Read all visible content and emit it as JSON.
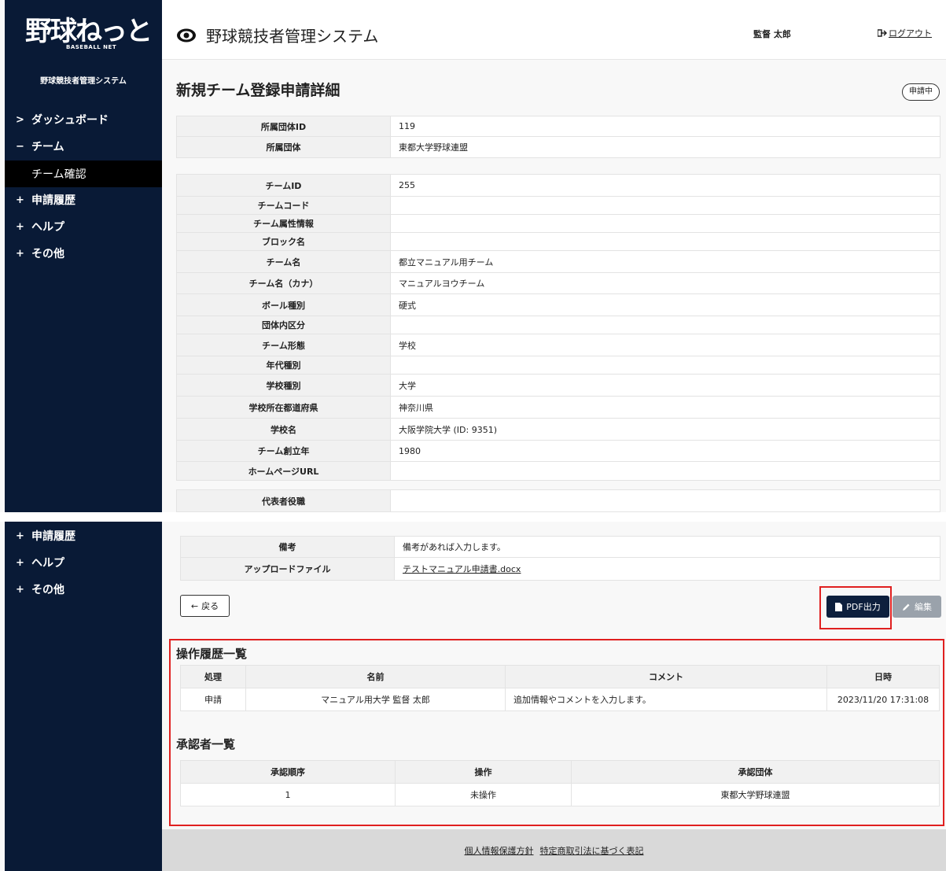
{
  "sidebar": {
    "logo_text": "野球ねっと",
    "logo_sub": "BASEBALL NET",
    "system_name": "野球競技者管理システム",
    "menu": [
      {
        "mark": ">",
        "label": "ダッシュボード"
      },
      {
        "mark": "−",
        "label": "チーム"
      },
      {
        "sub": "チーム確認"
      },
      {
        "mark": "+",
        "label": "申請履歴"
      },
      {
        "mark": "+",
        "label": "ヘルプ"
      },
      {
        "mark": "+",
        "label": "その他"
      }
    ]
  },
  "header": {
    "app_title": "野球競技者管理システム",
    "user_name": "監督 太郎",
    "logout": "ログアウト"
  },
  "page": {
    "title": "新規チーム登録申請詳細",
    "status": "申請中"
  },
  "group_table": [
    {
      "label": "所属団体ID",
      "value": "119"
    },
    {
      "label": "所属団体",
      "value": "東都大学野球連盟"
    }
  ],
  "team_table": [
    {
      "label": "チームID",
      "value": "255"
    },
    {
      "label": "チームコード",
      "value": ""
    },
    {
      "label": "チーム属性情報",
      "value": ""
    },
    {
      "label": "ブロック名",
      "value": ""
    },
    {
      "label": "チーム名",
      "value": "都立マニュアル用チーム"
    },
    {
      "label": "チーム名（カナ）",
      "value": "マニュアルヨウチーム"
    },
    {
      "label": "ボール種別",
      "value": "硬式"
    },
    {
      "label": "団体内区分",
      "value": ""
    },
    {
      "label": "チーム形態",
      "value": "学校"
    },
    {
      "label": "年代種別",
      "value": ""
    },
    {
      "label": "学校種別",
      "value": "大学"
    },
    {
      "label": "学校所在都道府県",
      "value": "神奈川県"
    },
    {
      "label": "学校名",
      "value": "大阪学院大学 (ID: 9351)"
    },
    {
      "label": "チーム創立年",
      "value": "1980"
    },
    {
      "label": "ホームページURL",
      "value": ""
    }
  ],
  "rep_table": [
    {
      "label": "代表者役職",
      "value": ""
    }
  ],
  "bottom_table": [
    {
      "label": "備考",
      "value": "備考があれば入力します。"
    },
    {
      "label": "アップロードファイル",
      "value": "テストマニュアル申請書.docx"
    }
  ],
  "buttons": {
    "back": "戻る",
    "pdf": "PDF出力",
    "edit": "編集"
  },
  "history": {
    "title": "操作履歴一覧",
    "headers": [
      "処理",
      "名前",
      "コメント",
      "日時"
    ],
    "rows": [
      [
        "申請",
        "マニュアル用大学 監督 太郎",
        "追加情報やコメントを入力します。",
        "2023/11/20 17:31:08"
      ]
    ]
  },
  "approvers": {
    "title": "承認者一覧",
    "headers": [
      "承認順序",
      "操作",
      "承認団体"
    ],
    "rows": [
      [
        "1",
        "未操作",
        "東都大学野球連盟"
      ]
    ]
  },
  "footer": {
    "privacy": "個人情報保護方針",
    "commerce": "特定商取引法に基づく表記"
  },
  "colors": {
    "sidebar_bg": "#091a36",
    "highlight": "#e02020",
    "primary_button": "#0d1f3d"
  }
}
